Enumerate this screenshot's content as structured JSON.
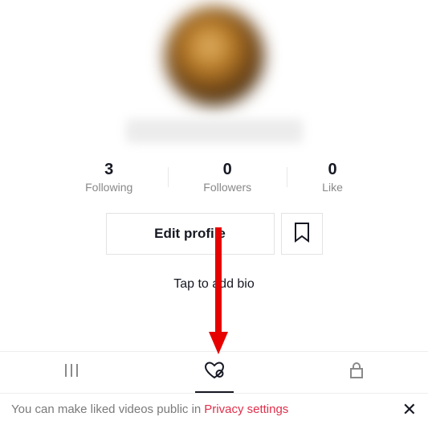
{
  "stats": {
    "following": {
      "value": "3",
      "label": "Following"
    },
    "followers": {
      "value": "0",
      "label": "Followers"
    },
    "like": {
      "value": "0",
      "label": "Like"
    }
  },
  "actions": {
    "edit_label": "Edit profile"
  },
  "bio": {
    "placeholder": "Tap to add bio"
  },
  "icons": {
    "bookmark": "bookmark-icon",
    "feed": "feed-icon",
    "liked": "heart-off-icon",
    "private": "lock-icon"
  },
  "banner": {
    "text": "You can make liked videos public in",
    "link": "Privacy settings",
    "close": "✕"
  },
  "colors": {
    "accent": "#e02f4b",
    "text": "#161823",
    "muted": "#888"
  }
}
